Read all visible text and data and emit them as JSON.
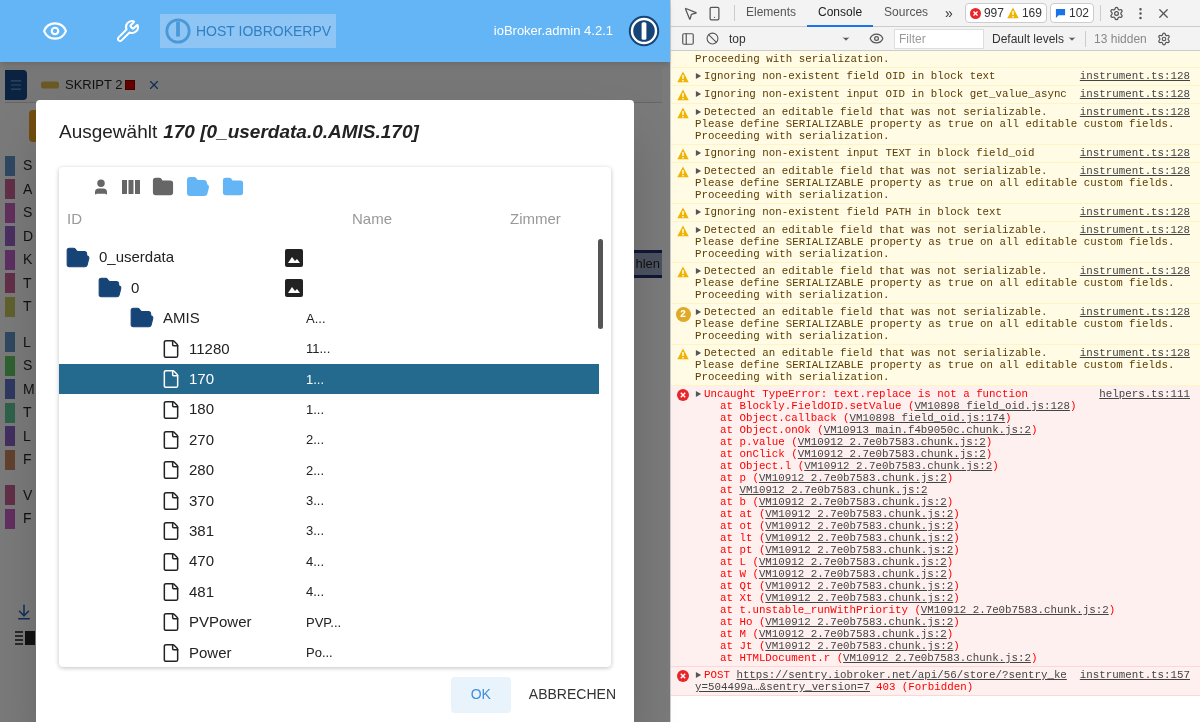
{
  "topbar": {
    "host": "HOST IOBROKERPV",
    "version": "ioBroker.admin 4.2.1"
  },
  "background_app": {
    "tab": {
      "label": "SKRIPT 2"
    },
    "side_button": "hlen",
    "menu_groups": [
      {
        "items": [
          {
            "letter": "S",
            "color": "#2f4861"
          },
          {
            "letter": "A",
            "color": "#612f48"
          },
          {
            "letter": "S",
            "color": "#612f5c"
          },
          {
            "letter": "D",
            "color": "#4a2f61"
          },
          {
            "letter": "K",
            "color": "#5c2f61"
          },
          {
            "letter": "T",
            "color": "#612f48"
          },
          {
            "letter": "T",
            "color": "#61612f"
          }
        ]
      },
      {
        "items": [
          {
            "letter": "L",
            "color": "#2f4861"
          },
          {
            "letter": "S",
            "color": "#2f612f"
          },
          {
            "letter": "M",
            "color": "#2f3961"
          },
          {
            "letter": "T",
            "color": "#2f614a"
          },
          {
            "letter": "L",
            "color": "#422f61"
          },
          {
            "letter": "F",
            "color": "#61422f"
          }
        ]
      },
      {
        "items": [
          {
            "letter": "V",
            "color": "#612f48"
          },
          {
            "letter": "F",
            "color": "#612f61"
          }
        ]
      }
    ]
  },
  "dialog": {
    "title_label": "Ausgewählt",
    "selection": "170 [0_userdata.0.AMIS.170]",
    "columns": [
      "ID",
      "Name",
      "Zimmer"
    ],
    "tree": [
      {
        "id": "0_userdata",
        "kind": "folder",
        "has_image": true,
        "selected": false,
        "children": [
          {
            "id": "0",
            "kind": "folder",
            "has_image": true,
            "selected": false,
            "children": [
              {
                "id": "AMIS",
                "kind": "folder",
                "name": "A...",
                "selected": false,
                "children": [
                  {
                    "id": "11280",
                    "kind": "state",
                    "name": "11...",
                    "selected": false
                  },
                  {
                    "id": "170",
                    "kind": "state",
                    "name": "1...",
                    "selected": true
                  },
                  {
                    "id": "180",
                    "kind": "state",
                    "name": "1...",
                    "selected": false
                  },
                  {
                    "id": "270",
                    "kind": "state",
                    "name": "2...",
                    "selected": false
                  },
                  {
                    "id": "280",
                    "kind": "state",
                    "name": "2...",
                    "selected": false
                  },
                  {
                    "id": "370",
                    "kind": "state",
                    "name": "3...",
                    "selected": false
                  },
                  {
                    "id": "381",
                    "kind": "state",
                    "name": "3...",
                    "selected": false
                  },
                  {
                    "id": "470",
                    "kind": "state",
                    "name": "4...",
                    "selected": false
                  },
                  {
                    "id": "481",
                    "kind": "state",
                    "name": "4...",
                    "selected": false
                  },
                  {
                    "id": "PVPower",
                    "kind": "state",
                    "name": "PVP...",
                    "selected": false
                  },
                  {
                    "id": "Power",
                    "kind": "state",
                    "name": "Po...",
                    "selected": false
                  }
                ]
              }
            ]
          }
        ]
      }
    ],
    "buttons": [
      "OK",
      "ABBRECHEN"
    ]
  },
  "devtools": {
    "tabs": [
      {
        "label": "Elements",
        "selected": false
      },
      {
        "label": "Console",
        "selected": true
      },
      {
        "label": "Sources",
        "selected": false
      }
    ],
    "more": "»",
    "errors": "997",
    "warnings": "169",
    "infos": "102",
    "context": "top",
    "filter_placeholder": "Filter",
    "levels": "Default levels",
    "hidden": "13 hidden",
    "messages": [
      {
        "kind": "continuation",
        "lines": [
          "Proceeding with serialization."
        ]
      },
      {
        "kind": "warning",
        "lines": [
          "Ignoring non-existent field OID in block text"
        ],
        "source": "instrument.ts:128"
      },
      {
        "kind": "warning",
        "lines": [
          "Ignoring non-existent input OID in block get_value_async"
        ],
        "source": "instrument.ts:128"
      },
      {
        "kind": "warning",
        "lines": [
          "Detected an editable field that was not serializable.",
          "Please define SERIALIZABLE property as true on all editable custom fields.",
          "Proceeding with serialization."
        ],
        "source": "instrument.ts:128"
      },
      {
        "kind": "warning",
        "lines": [
          "Ignoring non-existent input TEXT in block field_oid"
        ],
        "source": "instrument.ts:128"
      },
      {
        "kind": "warning",
        "lines": [
          "Detected an editable field that was not serializable.",
          "Please define SERIALIZABLE property as true on all editable custom fields.",
          "Proceeding with serialization."
        ],
        "source": "instrument.ts:128"
      },
      {
        "kind": "warning",
        "lines": [
          "Ignoring non-existent field PATH in block text"
        ],
        "source": "instrument.ts:128"
      },
      {
        "kind": "warning",
        "lines": [
          "Detected an editable field that was not serializable.",
          "Please define SERIALIZABLE property as true on all editable custom fields.",
          "Proceeding with serialization."
        ],
        "source": "instrument.ts:128"
      },
      {
        "kind": "warning",
        "lines": [
          "Detected an editable field that was not serializable.",
          "Please define SERIALIZABLE property as true on all editable custom fields.",
          "Proceeding with serialization."
        ],
        "source": "instrument.ts:128"
      },
      {
        "kind": "warning",
        "repeat": "2",
        "lines": [
          "Detected an editable field that was not serializable.",
          "Please define SERIALIZABLE property as true on all editable custom fields.",
          "Proceeding with serialization."
        ],
        "source": "instrument.ts:128"
      },
      {
        "kind": "warning",
        "lines": [
          "Detected an editable field that was not serializable.",
          "Please define SERIALIZABLE property as true on all editable custom fields.",
          "Proceeding with serialization."
        ],
        "source": "instrument.ts:128"
      },
      {
        "kind": "error",
        "lines": [
          "Uncaught TypeError: text.replace is not a function"
        ],
        "source": "helpers.ts:111",
        "stack": [
          {
            "prefix": "at Blockly.FieldOID.setValue (",
            "location": "VM10898 field_oid.js:128",
            "suffix": ")"
          },
          {
            "prefix": "at Object.callback (",
            "location": "VM10898 field_oid.js:174",
            "suffix": ")"
          },
          {
            "prefix": "at Object.onOk (",
            "location": "VM10913 main.f4b9050c.chunk.js:2",
            "suffix": ")"
          },
          {
            "prefix": "at p.value (",
            "location": "VM10912 2.7e0b7583.chunk.js:2",
            "suffix": ")"
          },
          {
            "prefix": "at onClick (",
            "location": "VM10912 2.7e0b7583.chunk.js:2",
            "suffix": ")"
          },
          {
            "prefix": "at Object.l (",
            "location": "VM10912 2.7e0b7583.chunk.js:2",
            "suffix": ")"
          },
          {
            "prefix": "at p (",
            "location": "VM10912 2.7e0b7583.chunk.js:2",
            "suffix": ")"
          },
          {
            "prefix": "at",
            "location": "VM10912 2.7e0b7583.chunk.js:2"
          },
          {
            "prefix": "at b (",
            "location": "VM10912 2.7e0b7583.chunk.js:2",
            "suffix": ")"
          },
          {
            "prefix": "at at (",
            "location": "VM10912 2.7e0b7583.chunk.js:2",
            "suffix": ")"
          },
          {
            "prefix": "at ot (",
            "location": "VM10912 2.7e0b7583.chunk.js:2",
            "suffix": ")"
          },
          {
            "prefix": "at lt (",
            "location": "VM10912 2.7e0b7583.chunk.js:2",
            "suffix": ")"
          },
          {
            "prefix": "at pt (",
            "location": "VM10912 2.7e0b7583.chunk.js:2",
            "suffix": ")"
          },
          {
            "prefix": "at L (",
            "location": "VM10912 2.7e0b7583.chunk.js:2",
            "suffix": ")"
          },
          {
            "prefix": "at W (",
            "location": "VM10912 2.7e0b7583.chunk.js:2",
            "suffix": ")"
          },
          {
            "prefix": "at Qt (",
            "location": "VM10912 2.7e0b7583.chunk.js:2",
            "suffix": ")"
          },
          {
            "prefix": "at Xt (",
            "location": "VM10912 2.7e0b7583.chunk.js:2",
            "suffix": ")"
          },
          {
            "prefix": "at t.unstable_runWithPriority (",
            "location": "VM10912 2.7e0b7583.chunk.js:2",
            "suffix": ")"
          },
          {
            "prefix": "at Ho (",
            "location": "VM10912 2.7e0b7583.chunk.js:2",
            "suffix": ")"
          },
          {
            "prefix": "at M (",
            "location": "VM10912 2.7e0b7583.chunk.js:2",
            "suffix": ")"
          },
          {
            "prefix": "at Jt (",
            "location": "VM10912 2.7e0b7583.chunk.js:2",
            "suffix": ")"
          },
          {
            "prefix": "at HTMLDocument.r (",
            "location": "VM10912 2.7e0b7583.chunk.js:2",
            "suffix": ")"
          }
        ]
      },
      {
        "kind": "network_error",
        "method": "POST",
        "url_lines": [
          "https://sentry.iobroker.net/api/56/store/?sentry_ke",
          "y=504499a…&sentry_version=7"
        ],
        "status": "403 (Forbidden)",
        "source": "instrument.ts:157"
      }
    ]
  }
}
